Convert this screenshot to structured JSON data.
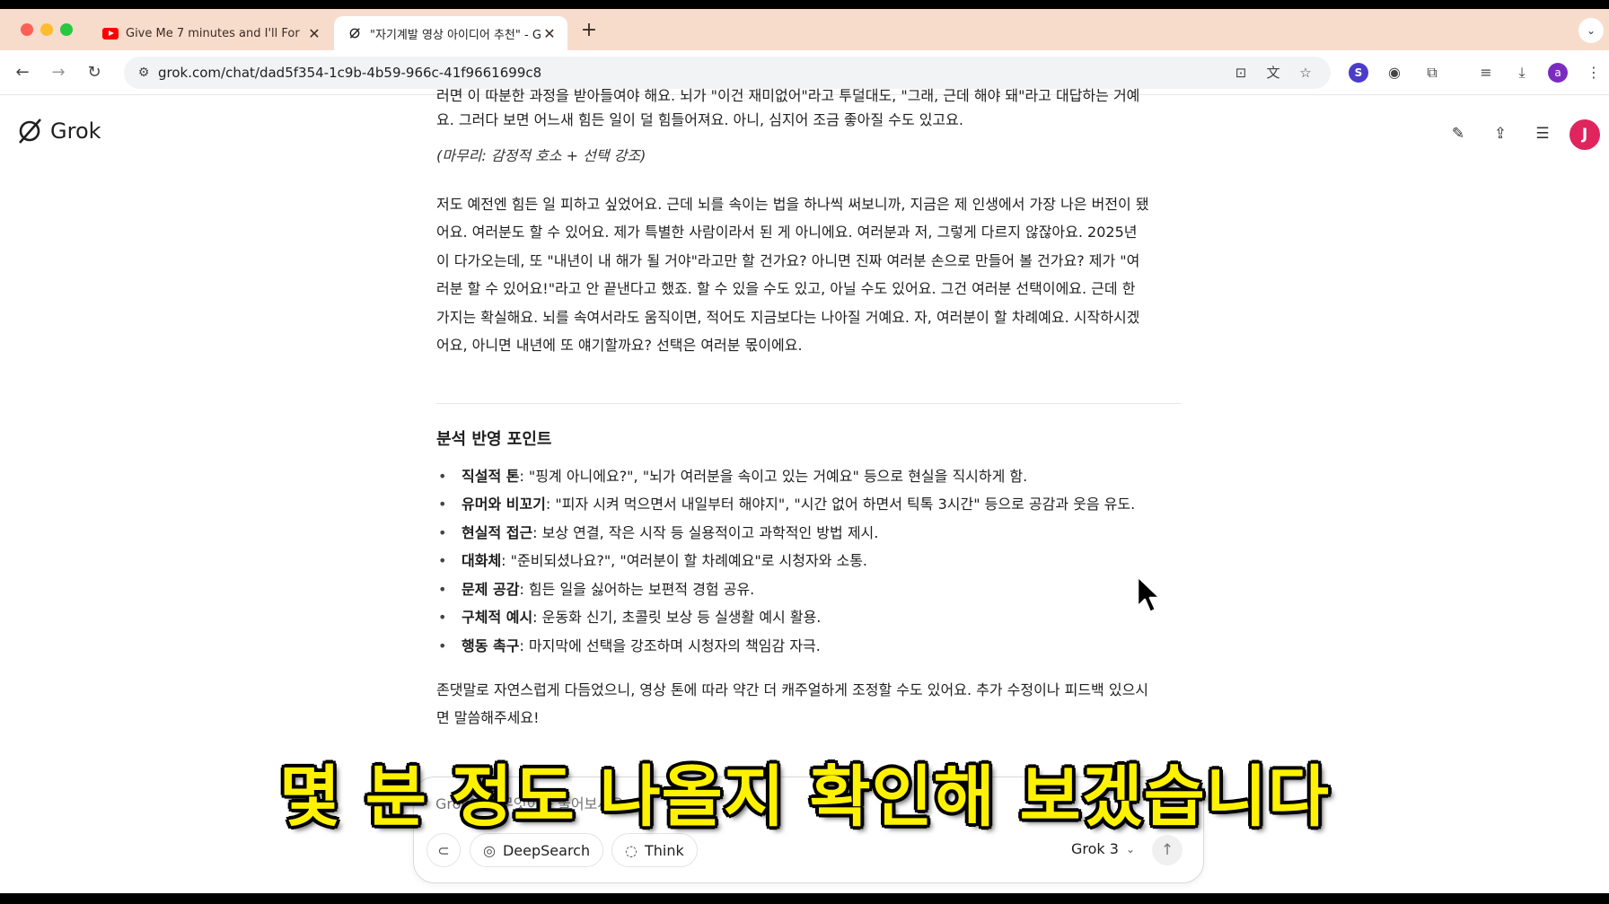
{
  "browser": {
    "tabs": [
      {
        "title": "Give Me 7 minutes and I'll For",
        "favicon": "youtube-icon",
        "active": false
      },
      {
        "title": "\"자기계발 영상 아이디어 추천\" - G",
        "favicon": "grok-icon",
        "active": true
      }
    ],
    "new_tab_label": "+",
    "url": "grok.com/chat/dad5f354-1c9b-4b59-966c-41f9661699c8",
    "extension_s": "S",
    "profile_initial": "a"
  },
  "app": {
    "name": "Grok",
    "user_initial": "J"
  },
  "message": {
    "cut_line": "러면 이 따분한 과정을 받아들여야 해요. 뇌가 \"이건 재미없어\"라고 투덜대도, \"그래, 근데 해야 돼\"라고 대답하는 거예",
    "line1": "요. 그러다 보면 어느새 힘든 일이 덜 힘들어져요. 아니, 심지어 조금 좋아질 수도 있고요.",
    "closing_label": "(마무리: 감정적 호소 + 선택 강조)",
    "para": [
      "저도 예전엔 힘든 일 피하고 싶었어요. 근데 뇌를 속이는 법을 하나씩 써보니까, 지금은 제 인생에서 가장 나은 버전이 됐",
      "어요. 여러분도 할 수 있어요. 제가 특별한 사람이라서 된 게 아니에요. 여러분과 저, 그렇게 다르지 않잖아요. 2025년",
      "이 다가오는데, 또 \"내년이 내 해가 될 거야\"라고만 할 건가요? 아니면 진짜 여러분 손으로 만들어 볼 건가요? 제가 \"여",
      "러분 할 수 있어요!\"라고 안 끝낸다고 했죠. 할 수 있을 수도 있고, 아닐 수도 있어요. 그건 여러분 선택이에요. 근데 한",
      "가지는 확실해요. 뇌를 속여서라도 움직이면, 적어도 지금보다는 나아질 거예요. 자, 여러분이 할 차례예요. 시작하시겠",
      "어요, 아니면 내년에 또 얘기할까요? 선택은 여러분 몫이에요."
    ],
    "section_title": "분석 반영 포인트",
    "bullets": [
      {
        "label": "직설적 톤",
        "text": ": \"핑계 아니에요?\", \"뇌가 여러분을 속이고 있는 거예요\" 등으로 현실을 직시하게 함."
      },
      {
        "label": "유머와 비꼬기",
        "text": ": \"피자 시켜 먹으면서 내일부터 해야지\", \"시간 없어 하면서 틱톡 3시간\" 등으로 공감과 웃음 유도."
      },
      {
        "label": "현실적 접근",
        "text": ": 보상 연결, 작은 시작 등 실용적이고 과학적인 방법 제시."
      },
      {
        "label": "대화체",
        "text": ": \"준비되셨나요?\", \"여러분이 할 차례예요\"로 시청자와 소통."
      },
      {
        "label": "문제 공감",
        "text": ": 힘든 일을 싫어하는 보편적 경험 공유."
      },
      {
        "label": "구체적 예시",
        "text": ": 운동화 신기, 초콜릿 보상 등 실생활 예시 활용."
      },
      {
        "label": "행동 촉구",
        "text": ": 마지막에 선택을 강조하며 시청자의 책임감 자극."
      }
    ],
    "final": [
      "존댓말로 자연스럽게 다듬었으니, 영상 톤에 따라 약간 더 캐주얼하게 조정할 수도 있어요. 추가 수정이나 피드백 있으시",
      "면 말씀해주세요!"
    ]
  },
  "composer": {
    "placeholder": "Grok에게 무엇이든 물어보세요",
    "deepsearch_label": "DeepSearch",
    "think_label": "Think",
    "model_label": "Grok 3"
  },
  "overlay": {
    "subtitle": "몇 분 정도 나올지 확인해 보겠습니다"
  }
}
